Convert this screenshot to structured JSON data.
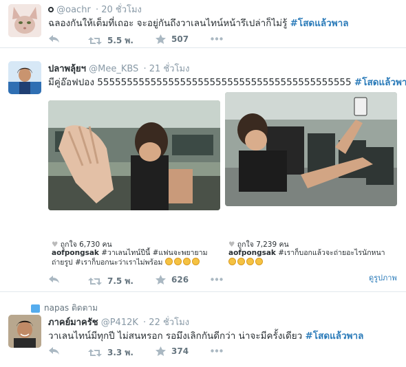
{
  "tweets": [
    {
      "handle_display": "@oachr",
      "time": "20 ชั่วโมง",
      "text": "ฉลองกันให้เต็มที่เถอะ จะอยู่กันถึงวาเลนไทน์หน้ารึเปล่าก็ไม่รู้ ",
      "hashtag": "#โสดแล้วพาล",
      "retweets": "5.5 พ.",
      "favorites": "507"
    },
    {
      "fullname": "ปลาพลุ้ยฯ",
      "handle": "@Mee_KBS",
      "time": "21 ชั่วโมง",
      "text": "มีคู่อ๊อฟปอง 5555555555555555555555555555555555555555555 ",
      "hashtag": "#โสดแล้วพาล",
      "retweets": "7.5 พ.",
      "favorites": "626",
      "photos": [
        {
          "likes": "ถูกใจ 6,730 คน",
          "caption_user": "aofpongsak",
          "caption_line1": "#วาเลนไทน์ปีนี้ #แฟนจะพยายาม",
          "caption_line2": "ถ่ายรูป #เราก็บอกนะว่าเราไม่พร้อม"
        },
        {
          "likes": "ถูกใจ 7,239 คน",
          "caption_user": "aofpongsak",
          "caption_line1": "#เราก็บอกแล้วจะถ่ายอะไรนักหนา",
          "caption_line2": ""
        }
      ],
      "view_photo": "ดูรูปภาพ"
    },
    {
      "followed_by": "napas ติดตาม",
      "fullname": "ภาคย์มาครัช",
      "handle": "@P412K",
      "time": "22 ชั่วโมง",
      "text": "วาเลนไทน์มีทุกปี ไม่สนหรอก รอมึงเลิกกันดีกว่า น่าจะมีครั้งเดียว ",
      "hashtag": "#โสดแล้วพาล",
      "retweets": "3.3 พ.",
      "favorites": "374"
    }
  ],
  "colors": {
    "link": "#2b7bb9",
    "meta": "#8899a6",
    "icon": "#aab8c2"
  },
  "icons": [
    "reply-icon",
    "retweet-icon",
    "favorite-star-icon",
    "more-dots-icon",
    "follow-bird-icon"
  ]
}
